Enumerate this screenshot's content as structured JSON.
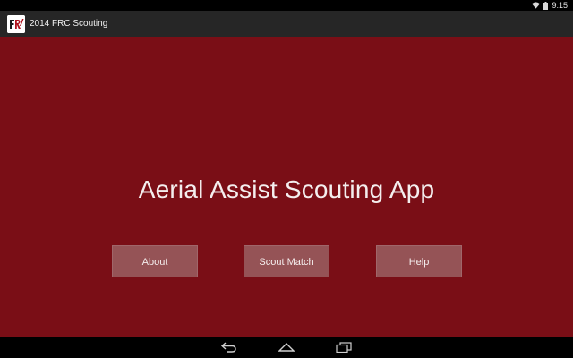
{
  "status_bar": {
    "time": "9:15",
    "icons": [
      "wifi-icon",
      "battery-icon"
    ]
  },
  "action_bar": {
    "title": "2014 FRC Scouting",
    "logo_icon": "frc-logo-icon"
  },
  "main": {
    "headline": "Aerial Assist Scouting App",
    "buttons": [
      {
        "label": "About"
      },
      {
        "label": "Scout Match"
      },
      {
        "label": "Help"
      }
    ]
  },
  "nav_bar": {
    "icons": [
      "back-icon",
      "home-icon",
      "recents-icon"
    ]
  },
  "colors": {
    "background": "#7a0e16",
    "button": "#955356",
    "action_bar": "#262626",
    "status_bar": "#000000"
  }
}
